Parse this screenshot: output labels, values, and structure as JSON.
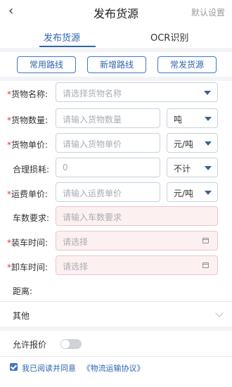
{
  "header": {
    "back_icon": "‹",
    "title": "发布货源",
    "right_action": "默认设置"
  },
  "tabs": [
    {
      "label": "发布货源",
      "active": true
    },
    {
      "label": "OCR识别",
      "active": false
    }
  ],
  "route_buttons": [
    "常用路线",
    "新增路线",
    "常发货源"
  ],
  "form": {
    "goods_name": {
      "label": "货物名称:",
      "required": true,
      "placeholder": "请选择货物名称"
    },
    "goods_qty": {
      "label": "货物数量:",
      "required": true,
      "placeholder": "请输入货物数量",
      "unit": "吨"
    },
    "goods_price": {
      "label": "货物单价:",
      "required": true,
      "placeholder": "请输入货物单价",
      "unit": "元/吨"
    },
    "loss": {
      "label": "合理损耗:",
      "required": false,
      "value": "0",
      "unit": "不计"
    },
    "freight_price": {
      "label": "运费单价:",
      "required": true,
      "placeholder": "请输入运费单价",
      "unit": "元/吨"
    },
    "truck_req": {
      "label": "车数要求:",
      "required": false,
      "placeholder": "请输入车数要求"
    },
    "load_time": {
      "label": "装车时间:",
      "required": true,
      "placeholder": "请选择"
    },
    "unload_time": {
      "label": "卸车时间:",
      "required": true,
      "placeholder": "请选择"
    },
    "distance": {
      "label": "距离:"
    },
    "other": {
      "label": "其他"
    },
    "allow_quote": {
      "label": "允许报价",
      "enabled": false
    }
  },
  "agreement": {
    "checked": true,
    "text": "我已阅读并同意",
    "link": "《物流运输协议》"
  },
  "colors": {
    "accent": "#2d64b0",
    "required": "#e33333",
    "pink_field": "#fdf0f1"
  }
}
